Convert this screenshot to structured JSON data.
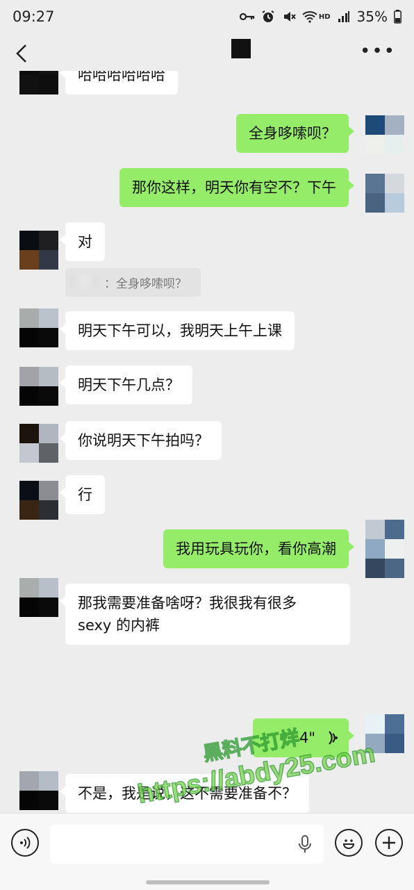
{
  "status_bar": {
    "time": "09:27",
    "network": "HD",
    "battery": "35%"
  },
  "header": {
    "back_icon": "chevron-left-icon",
    "more_icon": "more-dots-icon"
  },
  "messages": [
    {
      "dir": "in",
      "text": "哈哈哈哈哈哈"
    },
    {
      "dir": "out",
      "text": "全身哆嗦呗？"
    },
    {
      "dir": "out",
      "text": "那你这样，明天你有空不？下午"
    },
    {
      "dir": "in",
      "text": "对"
    },
    {
      "dir": "quote",
      "text": "：全身哆嗦呗？"
    },
    {
      "dir": "in",
      "text": "明天下午可以，我明天上午上课"
    },
    {
      "dir": "in",
      "text": "明天下午几点？"
    },
    {
      "dir": "in",
      "text": "你说明天下午拍吗？"
    },
    {
      "dir": "in",
      "text": "行"
    },
    {
      "dir": "out",
      "text": "我用玩具玩你，看你高潮"
    },
    {
      "dir": "in",
      "text_line1": "那我需要准备啥呀？我很我有很多",
      "text_line2": "sexy 的内裤"
    },
    {
      "dir": "out",
      "type": "voice",
      "duration": "4\""
    },
    {
      "dir": "in",
      "text": "不是，我是说，这不需要准备不？"
    }
  ],
  "watermark": {
    "line1": "黑料不打烊",
    "line2": "https://abdy25.com"
  },
  "input_bar": {
    "voice_icon": "voice-toggle-icon",
    "mic_icon": "microphone-icon",
    "emoji_icon": "emoji-icon",
    "plus_icon": "plus-icon"
  },
  "colors": {
    "outgoing_bubble": "#95ec69",
    "incoming_bubble": "#ffffff",
    "background": "#ededed"
  }
}
